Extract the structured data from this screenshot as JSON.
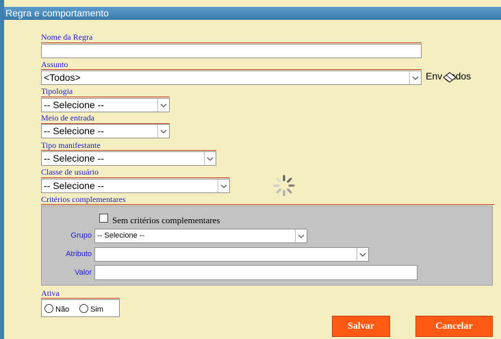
{
  "section_title": "Regra e comportamento",
  "fields": {
    "nome_label": "Nome da Regra",
    "nome_value": "",
    "assunto_label": "Assunto",
    "assunto_value": "<Todos>",
    "enviados_label": "Env    dados",
    "tipologia_label": "Tipologia",
    "tipologia_value": "-- Selecione --",
    "meio_label": "Meio de entrada",
    "meio_value": "-- Selecione --",
    "tipo_label": "Tipo manifestante",
    "tipo_value": "-- Selecione --",
    "classe_label": "Classe de usuário",
    "classe_value": "-- Selecione --",
    "criterios_label": "Critérios complementares"
  },
  "criterios": {
    "sem_label": "Sem critérios complementares",
    "sem_checked": false,
    "grupo_label": "Grupo",
    "grupo_value": "-- Selecione --",
    "atributo_label": "Atributo",
    "atributo_value": "",
    "valor_label": "Valor",
    "valor_value": ""
  },
  "ativa": {
    "label": "Ativa",
    "nao_label": "Não",
    "sim_label": "Sim",
    "selected": null
  },
  "buttons": {
    "save": "Salvar",
    "cancel": "Cancelar"
  },
  "icons": {
    "dropdown": "chevron-down-icon",
    "enviados": "eraser-icon",
    "loading": "loading-spinner-icon"
  },
  "colors": {
    "background": "#f4eec0",
    "title_bar": "#3f80b4",
    "label_text": "#1a1ad8",
    "underline": "#c63a2a",
    "button": "#ff5a14",
    "panel": "#c3c3c3"
  }
}
